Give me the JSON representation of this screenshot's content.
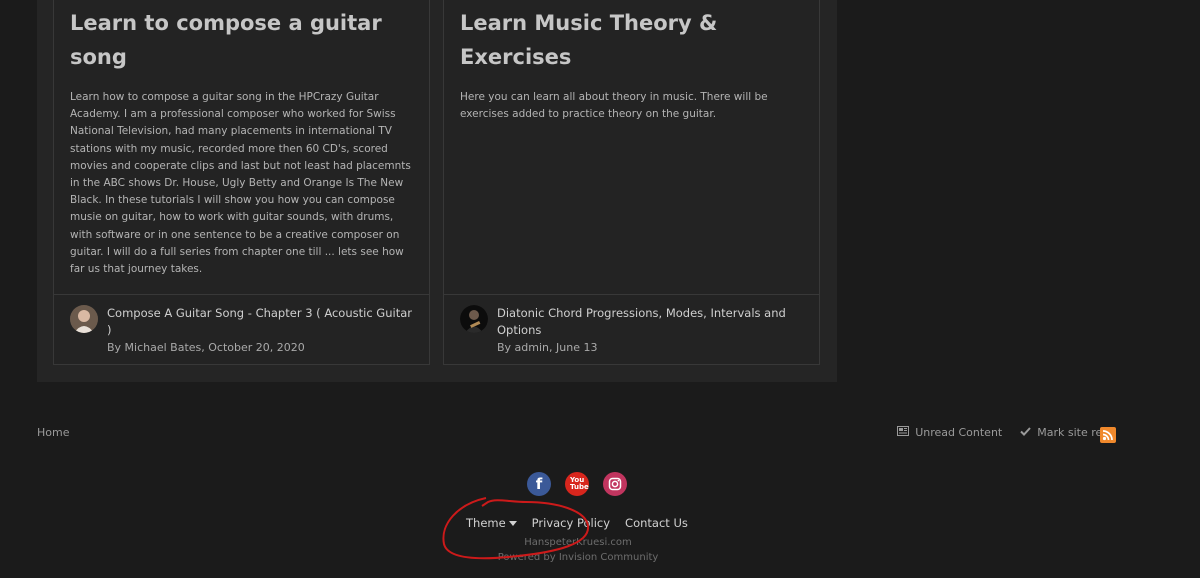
{
  "cards": [
    {
      "title": "Learn to compose a guitar song",
      "description": "Learn how to compose a guitar song in the HPCrazy Guitar Academy. I am a professional composer who worked for Swiss National Television, had many placements in international TV stations with my music, recorded more then 60 CD's, scored movies and cooperate clips and last but not least had placemnts in the ABC shows Dr. House, Ugly Betty and Orange Is The New Black. In these tutorials I will show you how you can compose musie on guitar, how to work with guitar sounds, with drums, with software or in one sentence to be a creative composer on guitar. I will do a full series from chapter one till ... lets see how far us that journey takes.",
      "latest_post": "Compose A Guitar Song - Chapter 3 ( Acoustic Guitar )",
      "meta": "By Michael Bates, October 20, 2020"
    },
    {
      "title": "Learn Music Theory & Exercises",
      "description": "Here you can learn all about theory in music. There will be exercises added to practice theory on the guitar.",
      "latest_post": "Diatonic Chord Progressions, Modes, Intervals and Options",
      "meta": "By admin, June 13"
    }
  ],
  "breadcrumb": {
    "home": "Home"
  },
  "footer_actions": {
    "unread": "Unread Content",
    "mark_read": "Mark site read"
  },
  "social": {
    "youtube_label": "You Tube"
  },
  "footer_links": {
    "theme": "Theme",
    "privacy": "Privacy Policy",
    "contact": "Contact Us"
  },
  "copyright": "HanspeterKruesi.com",
  "powered": "Powered by Invision Community",
  "colors": {
    "background": "#1b1b1b",
    "panel": "#252525",
    "rss": "#f0892c",
    "facebook": "#3b5998",
    "youtube": "#d8261d",
    "instagram": "#c1355f",
    "annotation": "#cc1a1a"
  }
}
